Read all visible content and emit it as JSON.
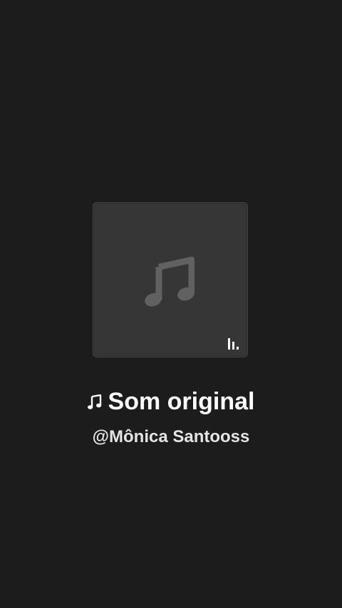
{
  "sound": {
    "title": "Som original",
    "author": "@Mônica Santooss"
  },
  "icons": {
    "cover_placeholder": "music-note-icon",
    "cover_badge": "audio-bars-icon",
    "title_prefix": "music-note-icon"
  },
  "colors": {
    "background": "#1c1c1c",
    "cover_background": "#363636",
    "cover_icon": "#616161",
    "title": "#ffffff",
    "author": "#e4e4e4"
  }
}
